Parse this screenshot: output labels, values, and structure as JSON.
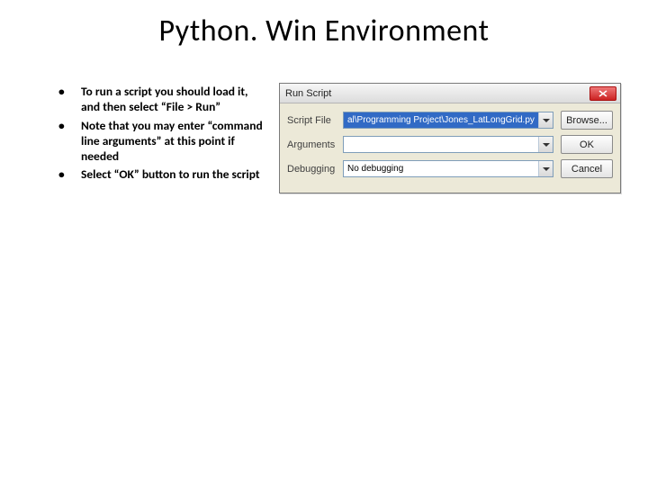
{
  "title": "Python. Win Environment",
  "bullets": [
    "To run a script you should load it, and then select “File > Run”",
    "Note that you may enter “command line arguments” at this point if needed",
    "Select “OK” button to run the script"
  ],
  "dialog": {
    "title": "Run Script",
    "labels": {
      "script": "Script File",
      "arguments": "Arguments",
      "debugging": "Debugging"
    },
    "fields": {
      "script_value": "al\\Programming Project\\Jones_LatLongGrid.py",
      "arguments_value": "",
      "debugging_value": "No debugging"
    },
    "buttons": {
      "browse": "Browse...",
      "ok": "OK",
      "cancel": "Cancel"
    }
  }
}
